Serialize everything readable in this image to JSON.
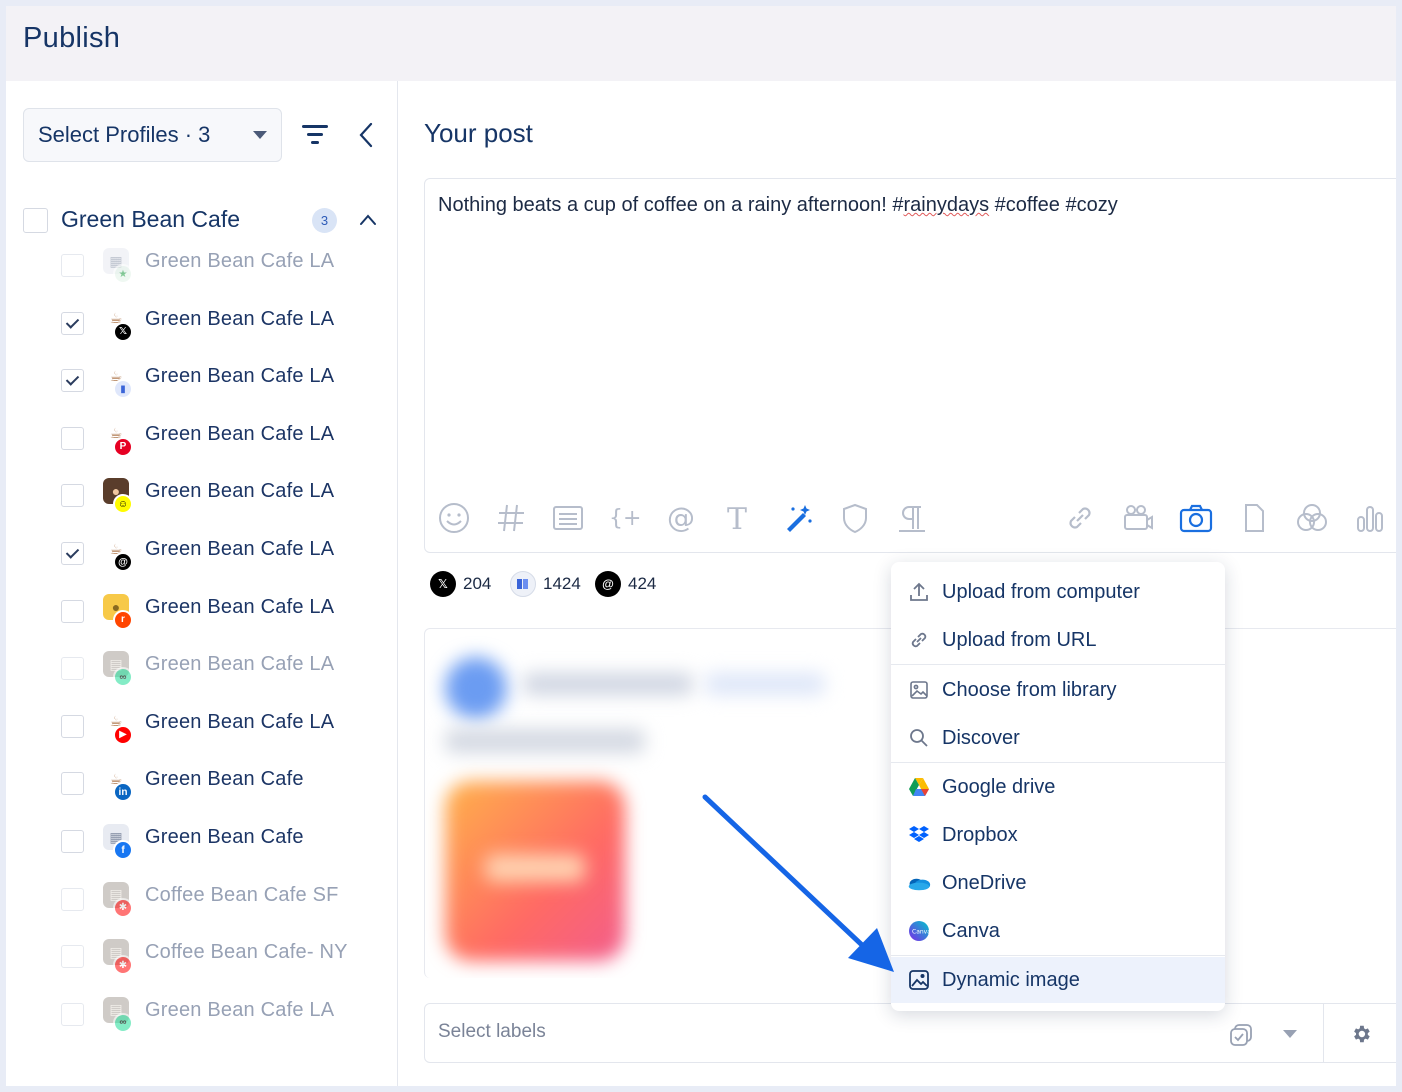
{
  "header": {
    "title": "Publish"
  },
  "sidebar": {
    "select_label": "Select Profiles · 3",
    "group": {
      "name": "Green Bean Cafe",
      "count": "3"
    },
    "profiles": [
      {
        "name": "Green Bean Cafe LA",
        "checked": false,
        "disabled": true,
        "network": "google-business",
        "avatar": "building"
      },
      {
        "name": "Green Bean Cafe LA",
        "checked": true,
        "disabled": false,
        "network": "x",
        "avatar": "cafe"
      },
      {
        "name": "Green Bean Cafe LA",
        "checked": true,
        "disabled": false,
        "network": "bluesky",
        "avatar": "cafe"
      },
      {
        "name": "Green Bean Cafe LA",
        "checked": false,
        "disabled": false,
        "network": "pinterest",
        "avatar": "cafe"
      },
      {
        "name": "Green Bean Cafe LA",
        "checked": false,
        "disabled": false,
        "network": "snapchat",
        "avatar": "person"
      },
      {
        "name": "Green Bean Cafe LA",
        "checked": true,
        "disabled": false,
        "network": "threads",
        "avatar": "cafe"
      },
      {
        "name": "Green Bean Cafe LA",
        "checked": false,
        "disabled": false,
        "network": "reddit",
        "avatar": "reddit"
      },
      {
        "name": "Green Bean Cafe LA",
        "checked": false,
        "disabled": true,
        "network": "tripadvisor",
        "avatar": "photo"
      },
      {
        "name": "Green Bean Cafe LA",
        "checked": false,
        "disabled": false,
        "network": "youtube",
        "avatar": "cafe"
      },
      {
        "name": "Green Bean Cafe",
        "checked": false,
        "disabled": false,
        "network": "linkedin",
        "avatar": "cafe"
      },
      {
        "name": "Green Bean Cafe",
        "checked": false,
        "disabled": false,
        "network": "facebook-page",
        "avatar": "building"
      },
      {
        "name": "Coffee Bean Cafe SF",
        "checked": false,
        "disabled": true,
        "network": "yelp",
        "avatar": "photo"
      },
      {
        "name": "Coffee Bean Cafe- NY",
        "checked": false,
        "disabled": true,
        "network": "yelp",
        "avatar": "photo"
      },
      {
        "name": "Green Bean Cafe LA",
        "checked": false,
        "disabled": true,
        "network": "tripadvisor",
        "avatar": "photo"
      }
    ]
  },
  "main": {
    "title": "Your post",
    "post_text_before": "Nothing beats a cup of coffee on a rainy afternoon! #",
    "post_text_misspelled": "rainydays",
    "post_text_after": " #coffee #cozy",
    "counters": [
      {
        "network": "x",
        "value": "204"
      },
      {
        "network": "bluesky",
        "value": "1424"
      },
      {
        "network": "threads",
        "value": "424"
      }
    ],
    "labels_placeholder": "Select labels"
  },
  "menu": {
    "items": [
      {
        "label": "Upload from computer",
        "icon": "upload-icon"
      },
      {
        "label": "Upload from URL",
        "icon": "link-icon"
      },
      {
        "label": "Choose from library",
        "icon": "image-icon"
      },
      {
        "label": "Discover",
        "icon": "search-icon"
      },
      {
        "label": "Google drive",
        "icon": "google-drive-icon"
      },
      {
        "label": "Dropbox",
        "icon": "dropbox-icon"
      },
      {
        "label": "OneDrive",
        "icon": "onedrive-icon"
      },
      {
        "label": "Canva",
        "icon": "canva-icon"
      },
      {
        "label": "Dynamic image",
        "icon": "dynamic-image-icon"
      }
    ]
  },
  "colors": {
    "primary": "#163566",
    "accent": "#1a6fe0",
    "arrow": "#1565e6"
  }
}
